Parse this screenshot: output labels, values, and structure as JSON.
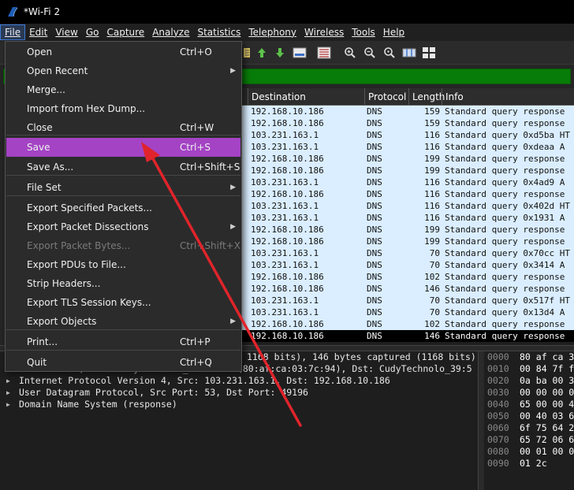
{
  "window": {
    "title": "*Wi-Fi 2"
  },
  "menubar": {
    "items": [
      {
        "id": "file",
        "label": "File"
      },
      {
        "id": "edit",
        "label": "Edit"
      },
      {
        "id": "view",
        "label": "View"
      },
      {
        "id": "go",
        "label": "Go"
      },
      {
        "id": "capture",
        "label": "Capture"
      },
      {
        "id": "analyze",
        "label": "Analyze"
      },
      {
        "id": "statistics",
        "label": "Statistics"
      },
      {
        "id": "telephony",
        "label": "Telephony"
      },
      {
        "id": "wireless",
        "label": "Wireless"
      },
      {
        "id": "tools",
        "label": "Tools"
      },
      {
        "id": "help",
        "label": "Help"
      }
    ]
  },
  "file_menu": {
    "items": [
      {
        "label": "Open",
        "shortcut": "Ctrl+O"
      },
      {
        "label": "Open Recent",
        "shortcut": "",
        "submenu": true
      },
      {
        "label": "Merge...",
        "shortcut": ""
      },
      {
        "label": "Import from Hex Dump...",
        "shortcut": ""
      },
      {
        "label": "Close",
        "shortcut": "Ctrl+W"
      },
      {
        "label": "Save",
        "shortcut": "Ctrl+S",
        "highlighted": true
      },
      {
        "label": "Save As...",
        "shortcut": "Ctrl+Shift+S"
      },
      {
        "label": "File Set",
        "shortcut": "",
        "submenu": true
      },
      {
        "label": "Export Specified Packets...",
        "shortcut": ""
      },
      {
        "label": "Export Packet Dissections",
        "shortcut": "",
        "submenu": true
      },
      {
        "label": "Export Packet Bytes...",
        "shortcut": "Ctrl+Shift+X",
        "disabled": true
      },
      {
        "label": "Export PDUs to File...",
        "shortcut": ""
      },
      {
        "label": "Strip Headers...",
        "shortcut": ""
      },
      {
        "label": "Export TLS Session Keys...",
        "shortcut": ""
      },
      {
        "label": "Export Objects",
        "shortcut": "",
        "submenu": true
      },
      {
        "label": "Print...",
        "shortcut": "Ctrl+P"
      },
      {
        "label": "Quit",
        "shortcut": "Ctrl+Q"
      }
    ]
  },
  "packet_list": {
    "columns": {
      "destination": "Destination",
      "protocol": "Protocol",
      "length": "Length",
      "info": "Info"
    },
    "rows": [
      {
        "dst": "192.168.10.186",
        "proto": "DNS",
        "len": "159",
        "info": "Standard query response"
      },
      {
        "dst": "192.168.10.186",
        "proto": "DNS",
        "len": "159",
        "info": "Standard query response"
      },
      {
        "dst": "103.231.163.1",
        "proto": "DNS",
        "len": "116",
        "info": "Standard query 0xd5ba HT"
      },
      {
        "dst": "103.231.163.1",
        "proto": "DNS",
        "len": "116",
        "info": "Standard query 0xdeaa A"
      },
      {
        "dst": "192.168.10.186",
        "proto": "DNS",
        "len": "199",
        "info": "Standard query response"
      },
      {
        "dst": "192.168.10.186",
        "proto": "DNS",
        "len": "199",
        "info": "Standard query response"
      },
      {
        "dst": "103.231.163.1",
        "proto": "DNS",
        "len": "116",
        "info": "Standard query 0x4ad9 A"
      },
      {
        "dst": "192.168.10.186",
        "proto": "DNS",
        "len": "116",
        "info": "Standard query response"
      },
      {
        "dst": "103.231.163.1",
        "proto": "DNS",
        "len": "116",
        "info": "Standard query 0x402d HT"
      },
      {
        "dst": "103.231.163.1",
        "proto": "DNS",
        "len": "116",
        "info": "Standard query 0x1931 A"
      },
      {
        "dst": "192.168.10.186",
        "proto": "DNS",
        "len": "199",
        "info": "Standard query response"
      },
      {
        "dst": "192.168.10.186",
        "proto": "DNS",
        "len": "199",
        "info": "Standard query response"
      },
      {
        "dst": "103.231.163.1",
        "proto": "DNS",
        "len": "70",
        "info": "Standard query 0x70cc HT"
      },
      {
        "dst": "103.231.163.1",
        "proto": "DNS",
        "len": "70",
        "info": "Standard query 0x3414 A"
      },
      {
        "dst": "192.168.10.186",
        "proto": "DNS",
        "len": "102",
        "info": "Standard query response"
      },
      {
        "dst": "192.168.10.186",
        "proto": "DNS",
        "len": "146",
        "info": "Standard query response"
      },
      {
        "dst": "103.231.163.1",
        "proto": "DNS",
        "len": "70",
        "info": "Standard query 0x517f HT"
      },
      {
        "dst": "103.231.163.1",
        "proto": "DNS",
        "len": "70",
        "info": "Standard query 0x13d4 A"
      },
      {
        "dst": "192.168.10.186",
        "proto": "DNS",
        "len": "102",
        "info": "Standard query response"
      },
      {
        "dst": "192.168.10.186",
        "proto": "DNS",
        "len": "146",
        "info": "Standard query response",
        "selected": true
      }
    ]
  },
  "details": {
    "rows": [
      "1168 bits), 146 bytes captured (1168 bits)",
      "Ethernet II, Src: CudyTechnolo_03:7c:94 (80:af:ca:03:7c:94), Dst: CudyTechnolo_39:5",
      "Internet Protocol Version 4, Src: 103.231.163.1, Dst: 192.168.10.186",
      "User Datagram Protocol, Src Port: 53, Dst Port: 49196",
      "Domain Name System (response)"
    ]
  },
  "bytes": {
    "rows": [
      {
        "off": "0000",
        "hex": "80 af ca 3"
      },
      {
        "off": "0010",
        "hex": "00 84 7f f"
      },
      {
        "off": "0020",
        "hex": "0a ba 00 3"
      },
      {
        "off": "0030",
        "hex": "00 00 00 0"
      },
      {
        "off": "0040",
        "hex": "65 00 00 4"
      },
      {
        "off": "0050",
        "hex": "00 40 03 6"
      },
      {
        "off": "0060",
        "hex": "6f 75 64 2"
      },
      {
        "off": "0070",
        "hex": "65 72 06 6"
      },
      {
        "off": "0080",
        "hex": "00 01 00 0"
      },
      {
        "off": "0090",
        "hex": "01 2c"
      }
    ]
  },
  "colors": {
    "highlight": "#a443c4",
    "filter_ok": "#087c08",
    "packet_row_bg": "#daeeff",
    "annotation_arrow": "#e0242b"
  }
}
